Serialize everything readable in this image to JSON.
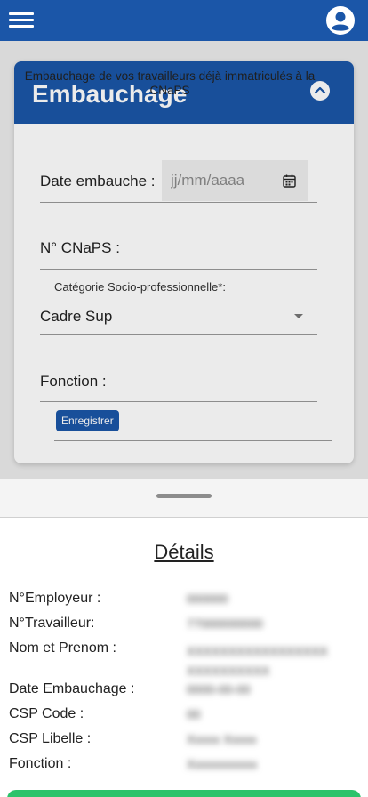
{
  "colors": {
    "primary": "#1b56a8",
    "accent_green": "#2cc36b"
  },
  "topbar": {
    "menu_icon": "hamburger-menu-icon",
    "account_icon": "account-circle-icon"
  },
  "card": {
    "title": "Embauchage",
    "collapse_icon": "chevron-up-circle-icon",
    "subtitle": "Embauchage de vos travailleurs déjà immatriculés à la CNaPS",
    "fields": {
      "date_label": "Date embauche :",
      "date_placeholder": "jj/mm/aaaa",
      "cnaps_label": "N° CNaPS :",
      "csp_label": "Catégorie Socio-professionnelle*:",
      "csp_value": "Cadre Sup",
      "fonction_label": "Fonction :"
    },
    "save_label": "Enregistrer"
  },
  "details": {
    "title": "Détails",
    "rows": [
      {
        "label": "N°Employeur :",
        "value": "000000"
      },
      {
        "label": "N°Travailleur:",
        "value": "77000000000"
      },
      {
        "label": "Nom et Prenom :",
        "value": "XXXXXXXXXXXXXXXXX XXXXXXXXXX"
      },
      {
        "label": "Date Embauchage :",
        "value": "0000-00-00"
      },
      {
        "label": "CSP Code :",
        "value": "00"
      },
      {
        "label": "CSP Libelle :",
        "value": "Xxxxx Xxxxx"
      },
      {
        "label": "Fonction :",
        "value": "Xxxxxxxxxxx"
      }
    ]
  }
}
